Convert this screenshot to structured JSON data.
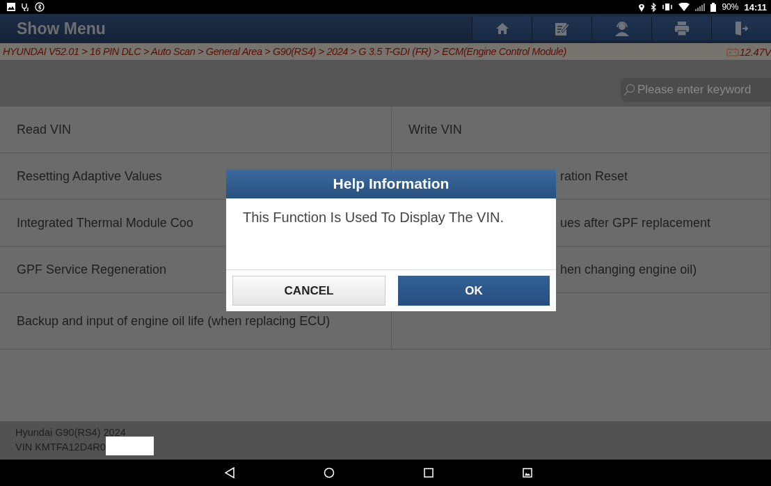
{
  "status_bar": {
    "percent": "90%",
    "time": "14:11"
  },
  "header": {
    "title": "Show Menu"
  },
  "breadcrumb": {
    "path": "HYUNDAI V52.01 > 16 PIN DLC > Auto Scan > General Area > G90(RS4) > 2024 > G 3.5 T-GDI (FR) > ECM(Engine Control Module)",
    "voltage": "12.47V"
  },
  "search": {
    "placeholder": "Please enter keyword"
  },
  "menu_items": [
    {
      "label": "Read VIN",
      "covered": false
    },
    {
      "label": "Write VIN",
      "covered": false
    },
    {
      "label": "Resetting Adaptive Values",
      "covered": false
    },
    {
      "label": "ration Reset",
      "covered": true
    },
    {
      "label": "Integrated Thermal Module Coo",
      "covered": false
    },
    {
      "label": "ues after GPF replacement",
      "covered": true
    },
    {
      "label": "GPF Service Regeneration",
      "covered": false
    },
    {
      "label": "hen changing engine oil)",
      "covered": true
    },
    {
      "label": "Backup and input of engine oil life (when replacing ECU)",
      "covered": false
    }
  ],
  "vehicle": {
    "model": "Hyundai G90(RS4) 2024",
    "vin": "VIN KMTFA12D4R0"
  },
  "dialog": {
    "title": "Help Information",
    "message": "This Function Is Used To Display The VIN.",
    "buttons": [
      {
        "label": "CANCEL",
        "kind": "secondary"
      },
      {
        "label": "OK",
        "kind": "primary"
      }
    ]
  }
}
